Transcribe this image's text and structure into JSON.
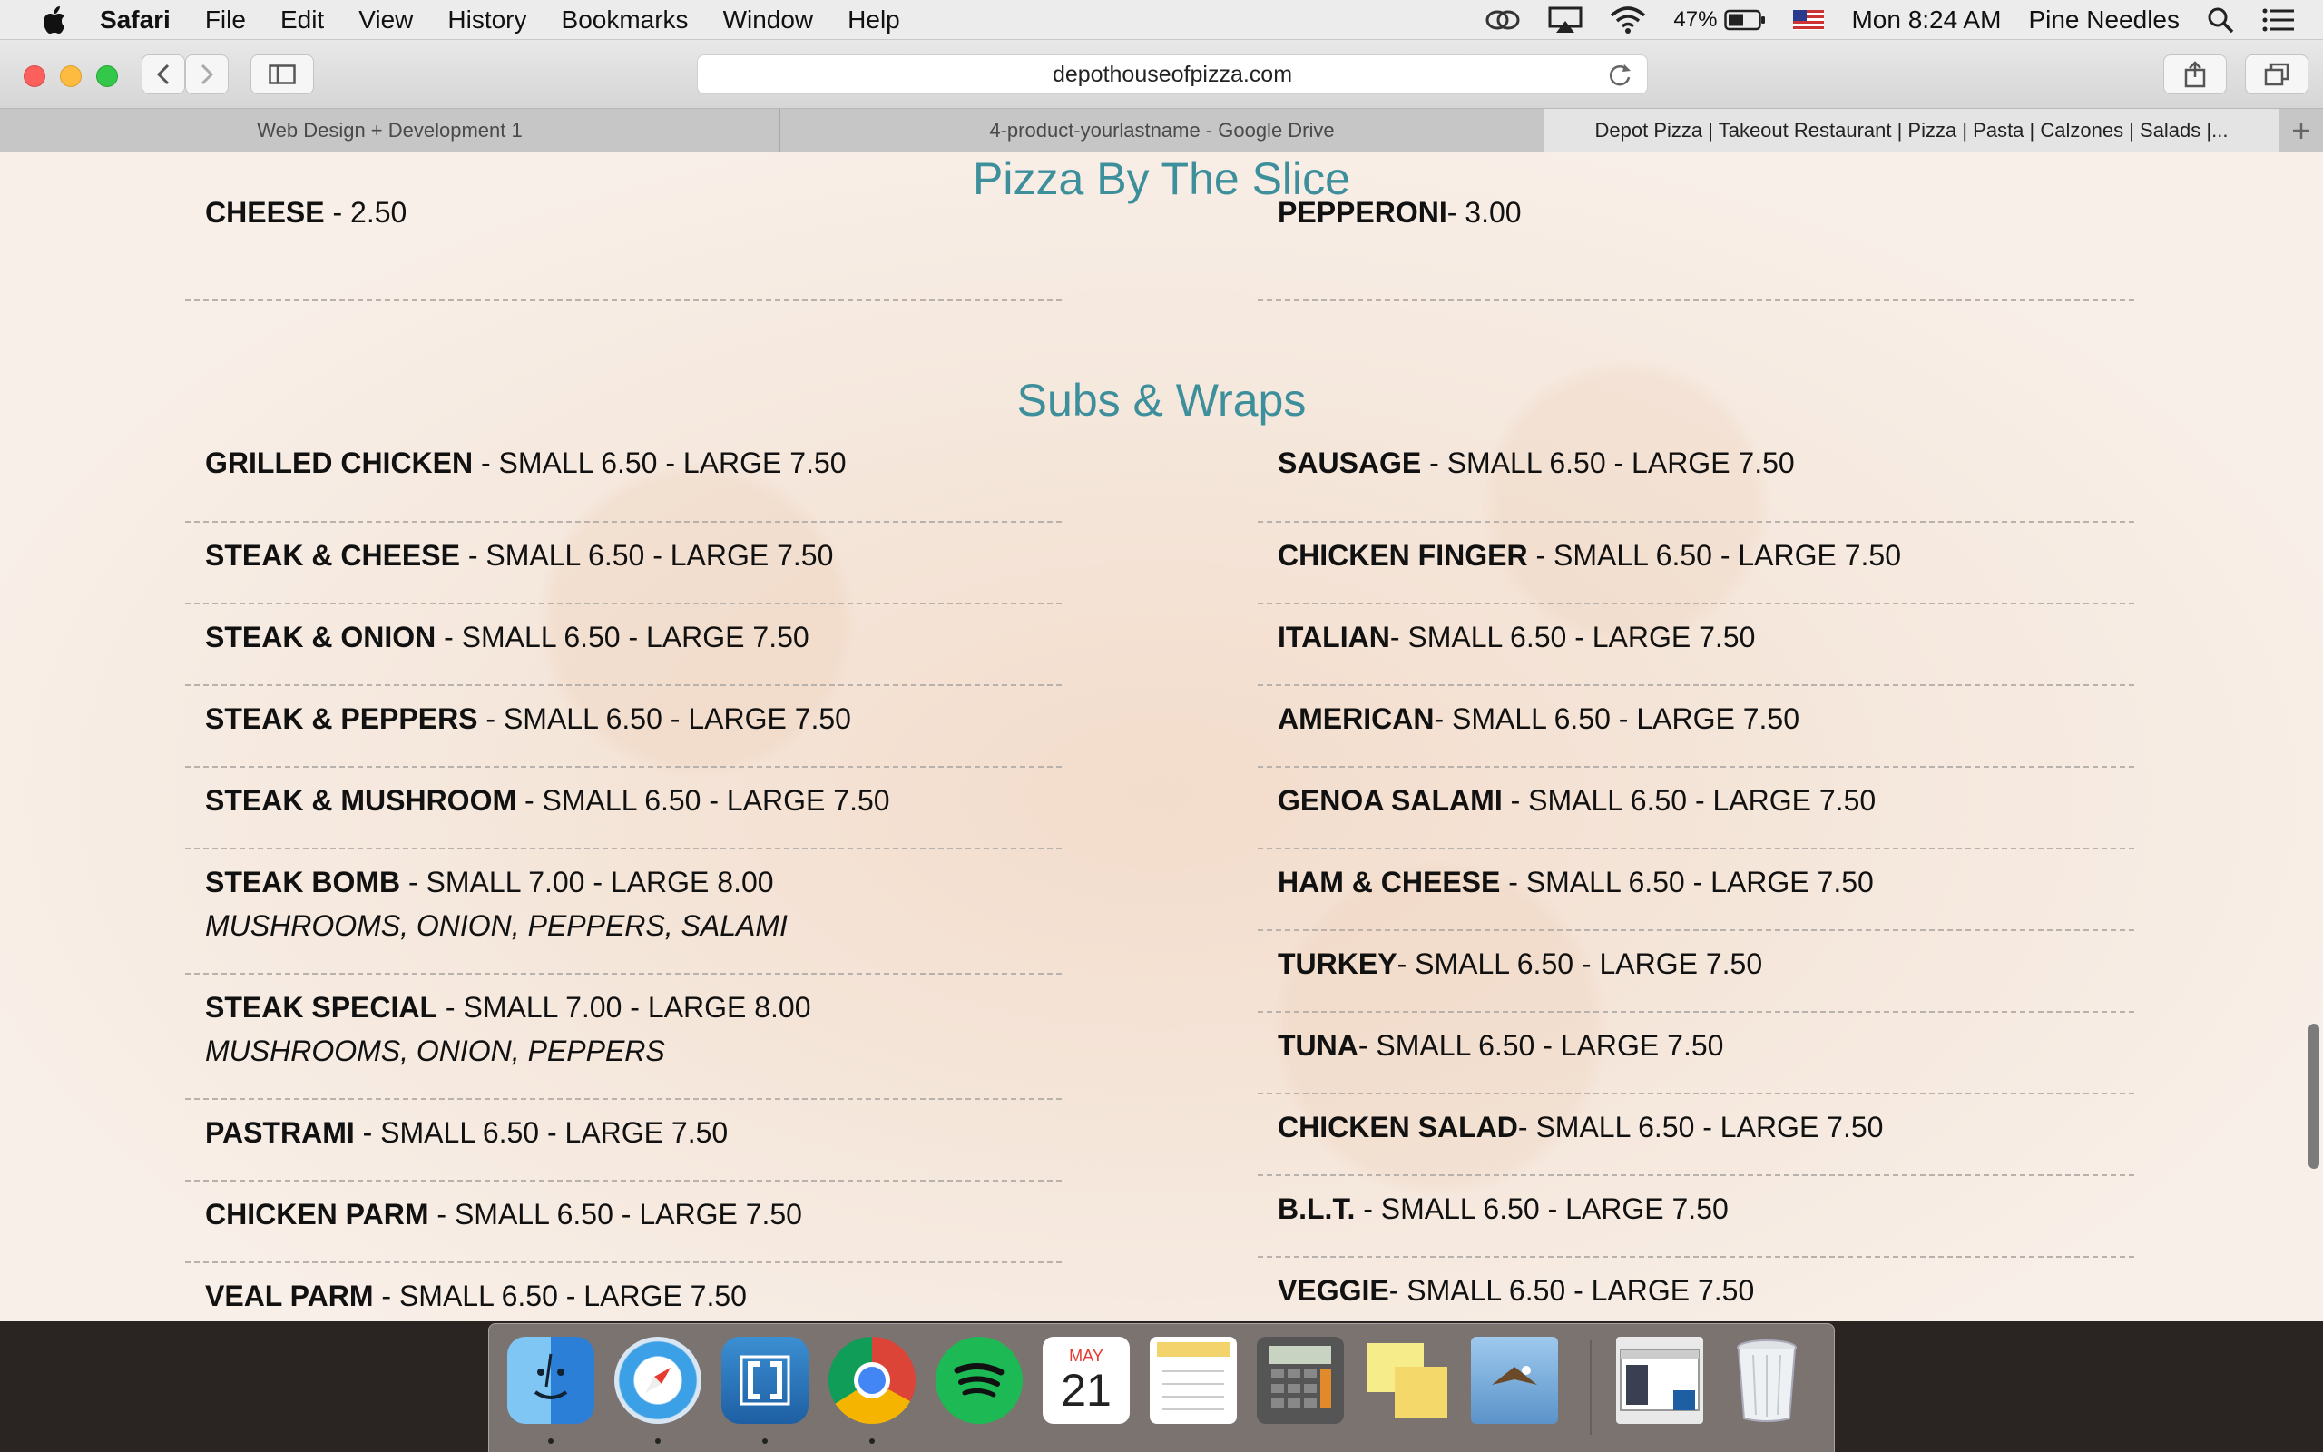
{
  "menubar": {
    "app_name": "Safari",
    "menus": [
      "File",
      "Edit",
      "View",
      "History",
      "Bookmarks",
      "Window",
      "Help"
    ],
    "battery": "47%",
    "clock": "Mon 8:24 AM",
    "user": "Pine Needles"
  },
  "toolbar": {
    "url": "depothouseofpizza.com"
  },
  "tabs": [
    {
      "label": "Web Design + Development 1",
      "active": false
    },
    {
      "label": "4-product-yourlastname - Google Drive",
      "active": false
    },
    {
      "label": "Depot Pizza | Takeout Restaurant | Pizza | Pasta | Calzones | Salads |...",
      "active": true
    }
  ],
  "menu": {
    "slice": {
      "title": "Pizza By The Slice",
      "left": [
        {
          "name": "CHEESE",
          "price": " - 2.50"
        }
      ],
      "right": [
        {
          "name": "PEPPERONI",
          "price": "- 3.00"
        }
      ]
    },
    "subs": {
      "title": "Subs & Wraps",
      "left": [
        {
          "name": "GRILLED CHICKEN",
          "price": " - SMALL 6.50 - LARGE 7.50",
          "desc": ""
        },
        {
          "name": "STEAK & CHEESE",
          "price": " - SMALL 6.50 - LARGE 7.50",
          "desc": ""
        },
        {
          "name": "STEAK & ONION",
          "price": " - SMALL 6.50 - LARGE 7.50",
          "desc": ""
        },
        {
          "name": "STEAK & PEPPERS",
          "price": " - SMALL 6.50 - LARGE 7.50",
          "desc": ""
        },
        {
          "name": "STEAK & MUSHROOM",
          "price": " - SMALL 6.50 - LARGE 7.50",
          "desc": ""
        },
        {
          "name": "STEAK BOMB",
          "price": " - SMALL 7.00 - LARGE 8.00",
          "desc": "MUSHROOMS, ONION, PEPPERS, SALAMI"
        },
        {
          "name": "STEAK SPECIAL",
          "price": " - SMALL 7.00 - LARGE 8.00",
          "desc": "MUSHROOMS, ONION, PEPPERS"
        },
        {
          "name": "PASTRAMI",
          "price": " - SMALL 6.50 - LARGE 7.50",
          "desc": ""
        },
        {
          "name": "CHICKEN PARM",
          "price": " - SMALL 6.50 - LARGE 7.50",
          "desc": ""
        },
        {
          "name": "VEAL PARM",
          "price": " - SMALL 6.50 - LARGE 7.50",
          "desc": ""
        }
      ],
      "right": [
        {
          "name": "SAUSAGE",
          "price": " - SMALL 6.50 - LARGE 7.50"
        },
        {
          "name": "CHICKEN FINGER",
          "price": " - SMALL 6.50 - LARGE 7.50"
        },
        {
          "name": "ITALIAN",
          "price": "- SMALL 6.50 - LARGE 7.50"
        },
        {
          "name": "AMERICAN",
          "price": "- SMALL 6.50 - LARGE 7.50"
        },
        {
          "name": "GENOA SALAMI",
          "price": " - SMALL 6.50 - LARGE 7.50"
        },
        {
          "name": "HAM & CHEESE",
          "price": " - SMALL 6.50 - LARGE 7.50"
        },
        {
          "name": "TURKEY",
          "price": "- SMALL 6.50 - LARGE 7.50"
        },
        {
          "name": "TUNA",
          "price": "- SMALL 6.50 - LARGE 7.50"
        },
        {
          "name": "CHICKEN SALAD",
          "price": "- SMALL 6.50 - LARGE 7.50"
        },
        {
          "name": "B.L.T.",
          "price": " - SMALL 6.50 - LARGE 7.50"
        },
        {
          "name": "VEGGIE",
          "price": "- SMALL 6.50 - LARGE 7.50"
        }
      ]
    }
  },
  "dock": {
    "apps": [
      "finder-icon",
      "safari-icon",
      "brackets-icon",
      "chrome-icon",
      "spotify-icon",
      "calendar-icon",
      "notes-icon",
      "calculator-icon",
      "stickies-icon",
      "mail-icon",
      "window-preview-icon",
      "trash-icon"
    ],
    "calendar_month": "MAY",
    "calendar_day": "21"
  },
  "colors": {
    "section_title": "#3d8f9c",
    "dashed_rule": "#b9b1ab"
  }
}
